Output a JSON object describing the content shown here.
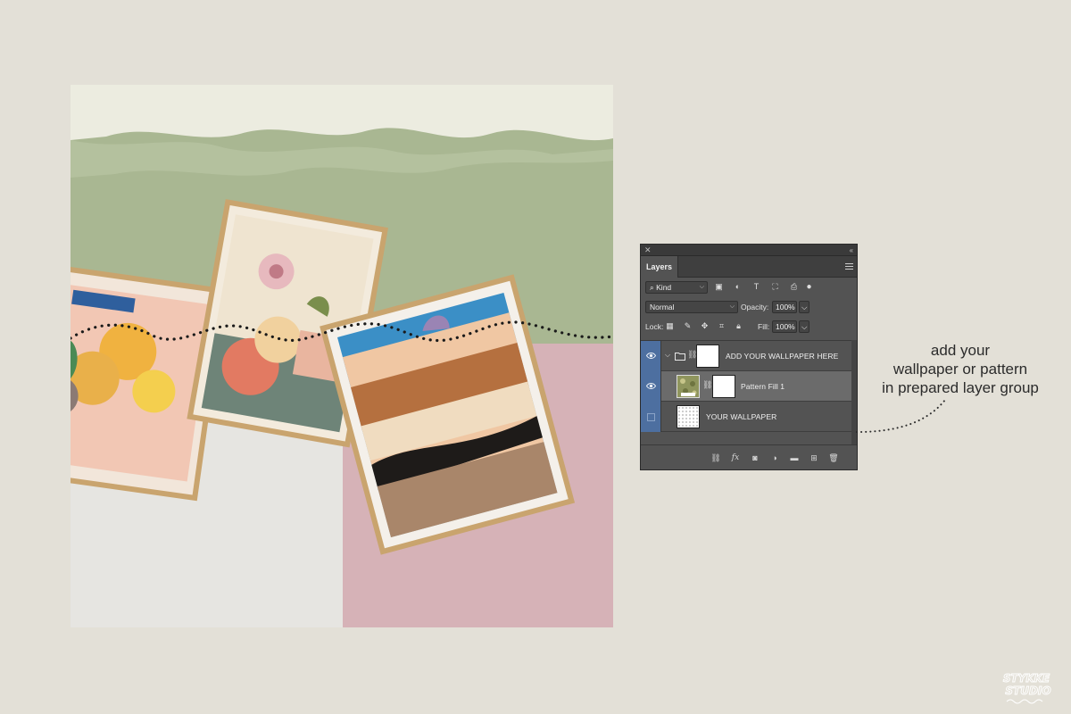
{
  "panel": {
    "tab_label": "Layers",
    "filter": {
      "label": "Kind"
    },
    "blend_mode": "Normal",
    "opacity": {
      "label": "Opacity:",
      "value": "100%"
    },
    "lock_label": "Lock:",
    "fill": {
      "label": "Fill:",
      "value": "100%"
    },
    "layers": [
      {
        "name": "ADD YOUR WALLPAPER HERE",
        "kind": "group",
        "visible": true,
        "expanded": true
      },
      {
        "name": "Pattern Fill 1",
        "kind": "pattern-fill",
        "visible": true,
        "selected": true
      },
      {
        "name": "YOUR WALLPAPER",
        "kind": "smart-object",
        "visible": false
      }
    ]
  },
  "annotation": {
    "lines": [
      "add your",
      "wallpaper or pattern",
      "in prepared layer group"
    ]
  },
  "logo": {
    "line1": "STYKKE",
    "line2": "STUDIO"
  },
  "colors": {
    "background": "#e3e0d7",
    "panel": "#535353",
    "selection_blue": "#4d6fa0",
    "wall_green": "#a9b792",
    "wall_pink": "#d6b2b7",
    "wall_white": "#e6e5e1"
  }
}
